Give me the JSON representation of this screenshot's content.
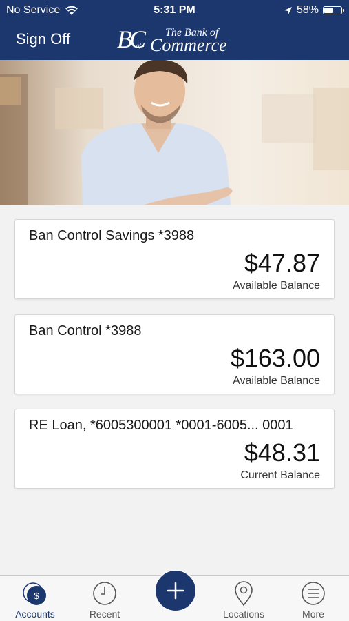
{
  "status_bar": {
    "carrier": "No Service",
    "time": "5:31 PM",
    "battery_percent": "58%",
    "battery_level": 0.58
  },
  "header": {
    "sign_off_label": "Sign Off",
    "logo": {
      "mark": "BC",
      "of": "of",
      "the_bank": "The Bank of",
      "commerce": "Commerce"
    }
  },
  "accounts": [
    {
      "name": "Ban Control Savings *3988",
      "amount": "$47.87",
      "balance_label": "Available Balance"
    },
    {
      "name": "Ban Control *3988",
      "amount": "$163.00",
      "balance_label": "Available Balance"
    },
    {
      "name": "RE Loan, *6005300001 *0001-6005... 0001",
      "amount": "$48.31",
      "balance_label": "Current Balance"
    }
  ],
  "tab_bar": {
    "accounts": {
      "label": "Accounts",
      "icon": "accounts-icon"
    },
    "recent": {
      "label": "Recent",
      "icon": "clock-icon"
    },
    "add": {
      "icon": "plus-icon"
    },
    "locations": {
      "label": "Locations",
      "icon": "location-pin-icon"
    },
    "more": {
      "label": "More",
      "icon": "menu-icon"
    }
  },
  "colors": {
    "brand": "#1c376e",
    "background": "#f2f2f2"
  }
}
